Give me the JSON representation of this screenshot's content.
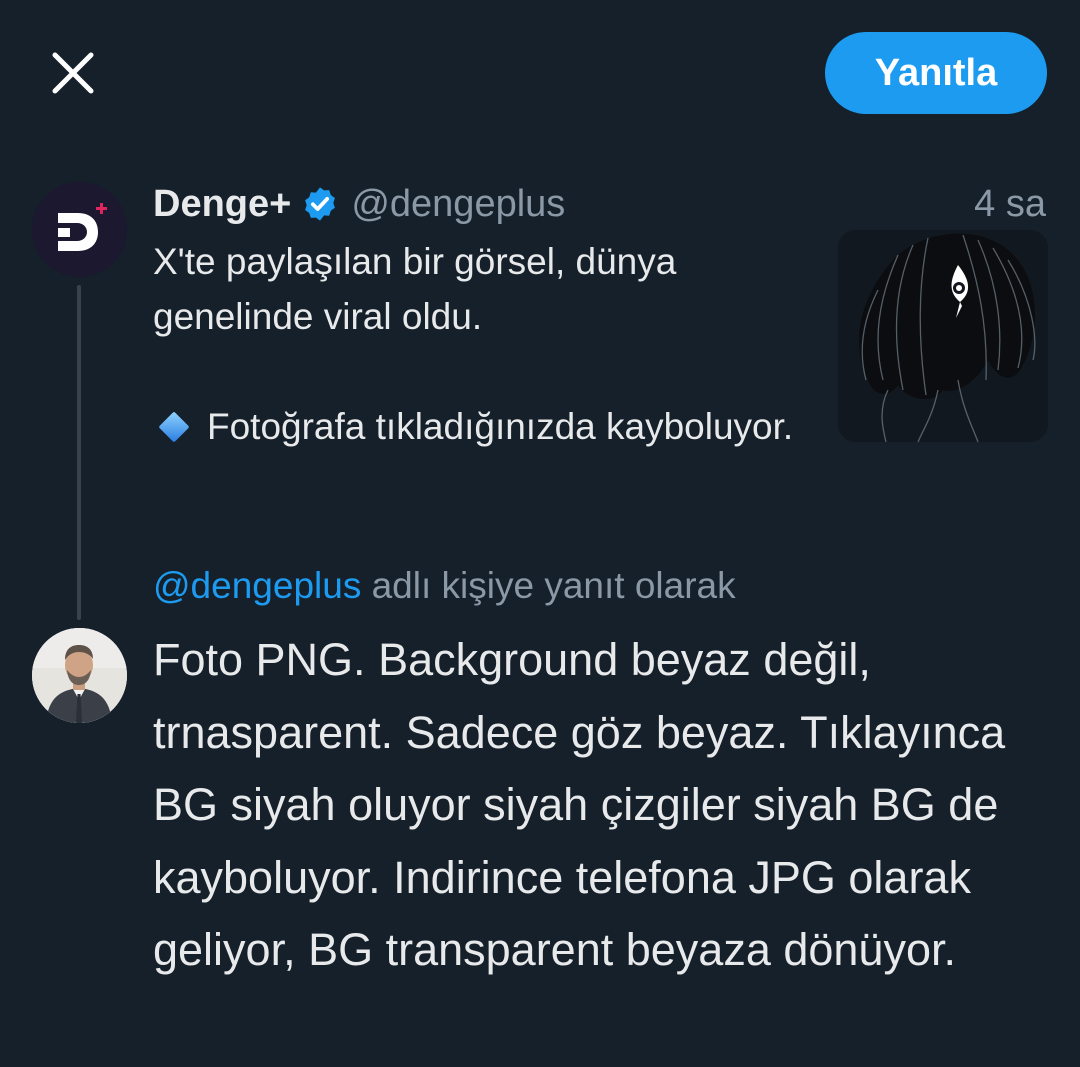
{
  "header": {
    "close_icon": "close-icon",
    "reply_button_label": "Yanıtla"
  },
  "original_tweet": {
    "display_name": "Denge+",
    "verified": true,
    "handle": "@dengeplus",
    "time": "4 sa",
    "text_line1": "X'te paylaşılan bir görsel, dünya genelinde viral oldu.",
    "text_line2_emoji": "small-blue-diamond-icon",
    "text_line2": "Fotoğrafa tıkladığınızda kayboluyor.",
    "media_icon": "image-thumbnail"
  },
  "reply": {
    "replying_to_mention": "@dengeplus",
    "replying_to_suffix": " adlı kişiye yanıt olarak",
    "text": "Foto PNG. Background beyaz değil, trnasparent. Sadece göz beyaz. Tıklayınca BG siyah oluyor siyah çizgiler siyah BG de kayboluyor. Indirince telefona JPG olarak geliyor, BG transparent beyaza dönüyor."
  },
  "colors": {
    "background": "#15202b",
    "accent": "#1d9bf0",
    "text_primary": "#e7e9ea",
    "text_secondary": "#8b98a5"
  }
}
